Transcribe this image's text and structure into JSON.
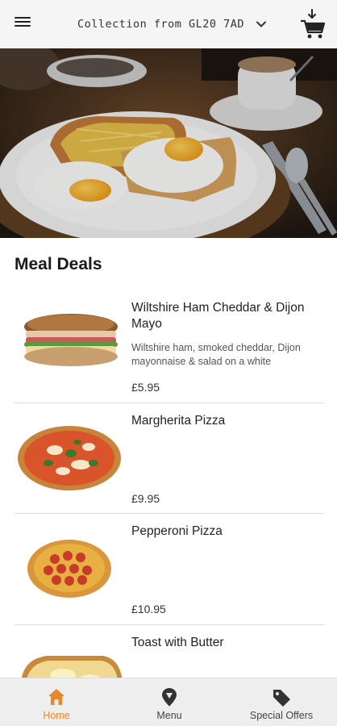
{
  "header": {
    "collection_label": "Collection from GL20 7AD"
  },
  "main": {
    "section_title": "Meal Deals",
    "items": [
      {
        "name": "Wiltshire Ham Cheddar & Dijon Mayo",
        "description": "Wiltshire ham, smoked cheddar, Dijon mayonnaise & salad on a white",
        "price": "£5.95"
      },
      {
        "name": "Margherita Pizza",
        "description": "",
        "price": "£9.95"
      },
      {
        "name": "Pepperoni Pizza",
        "description": "",
        "price": "£10.95"
      },
      {
        "name": "Toast with Butter",
        "description": "",
        "price": ""
      }
    ]
  },
  "bottom_nav": {
    "items": [
      {
        "label": "Home",
        "icon": "home-icon",
        "active": true
      },
      {
        "label": "Menu",
        "icon": "map-pin-icon",
        "active": false
      },
      {
        "label": "Special Offers",
        "icon": "tag-icon",
        "active": false
      }
    ]
  },
  "colors": {
    "accent": "#e8872a",
    "nav_background": "#eeeeee",
    "topbar_background": "#f5f5f5"
  }
}
